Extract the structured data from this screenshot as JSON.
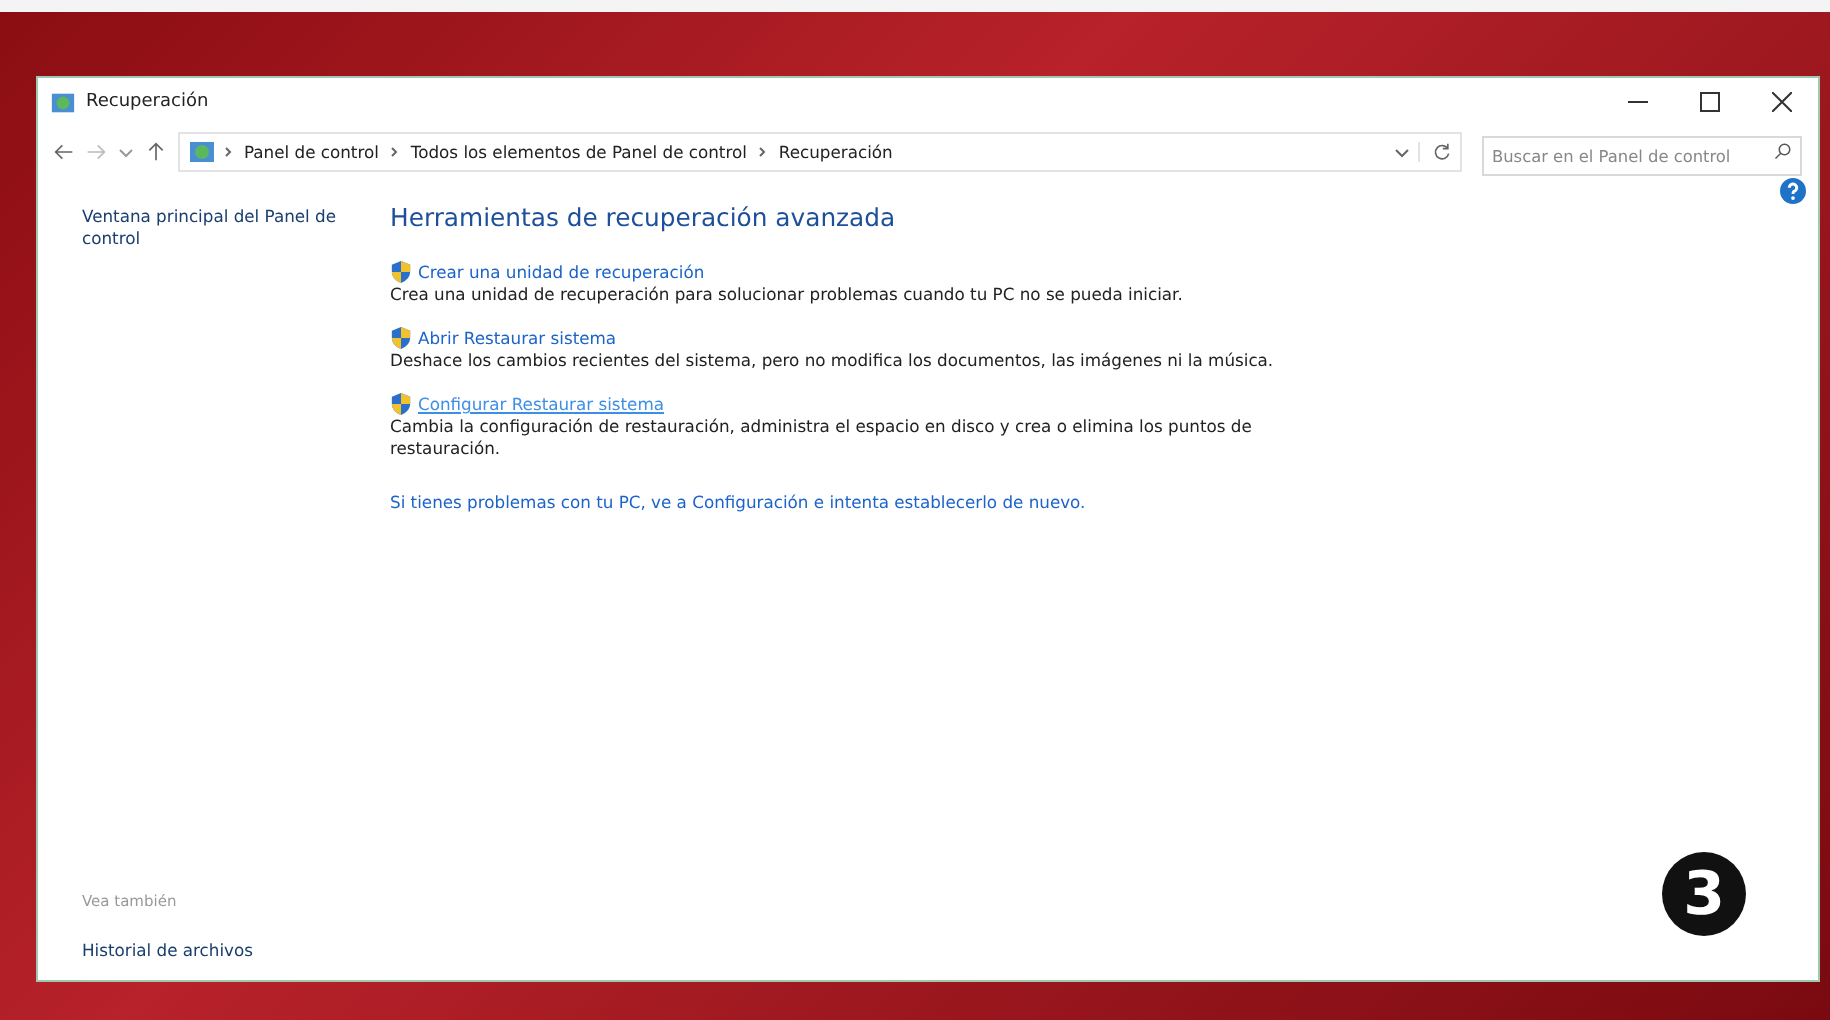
{
  "window": {
    "title": "Recuperación"
  },
  "address_bar": {
    "crumbs": [
      "Panel de control",
      "Todos los elementos de Panel de control",
      "Recuperación"
    ]
  },
  "search": {
    "placeholder": "Buscar en el Panel de control"
  },
  "sidebar": {
    "items": [
      {
        "label": "Ventana principal del Panel de control"
      }
    ],
    "see_also": {
      "heading": "Vea también",
      "items": [
        "Historial de archivos"
      ]
    }
  },
  "content": {
    "heading": "Herramientas de recuperación avanzada",
    "tools": [
      {
        "link": "Crear una unidad de recuperación",
        "description": "Crea una unidad de recuperación para solucionar problemas cuando tu PC no se pueda iniciar.",
        "hovered": false
      },
      {
        "link": "Abrir Restaurar sistema",
        "description": "Deshace los cambios recientes del sistema, pero no modifica los documentos, las imágenes ni la música.",
        "hovered": false
      },
      {
        "link": "Configurar Restaurar sistema",
        "description": "Cambia la configuración de restauración, administra el espacio en disco y crea o elimina los puntos de restauración.",
        "hovered": true
      }
    ],
    "footer_link": "Si tienes problemas con tu PC, ve a Configuración e intenta establecerlo de nuevo."
  },
  "step_badge": "3"
}
